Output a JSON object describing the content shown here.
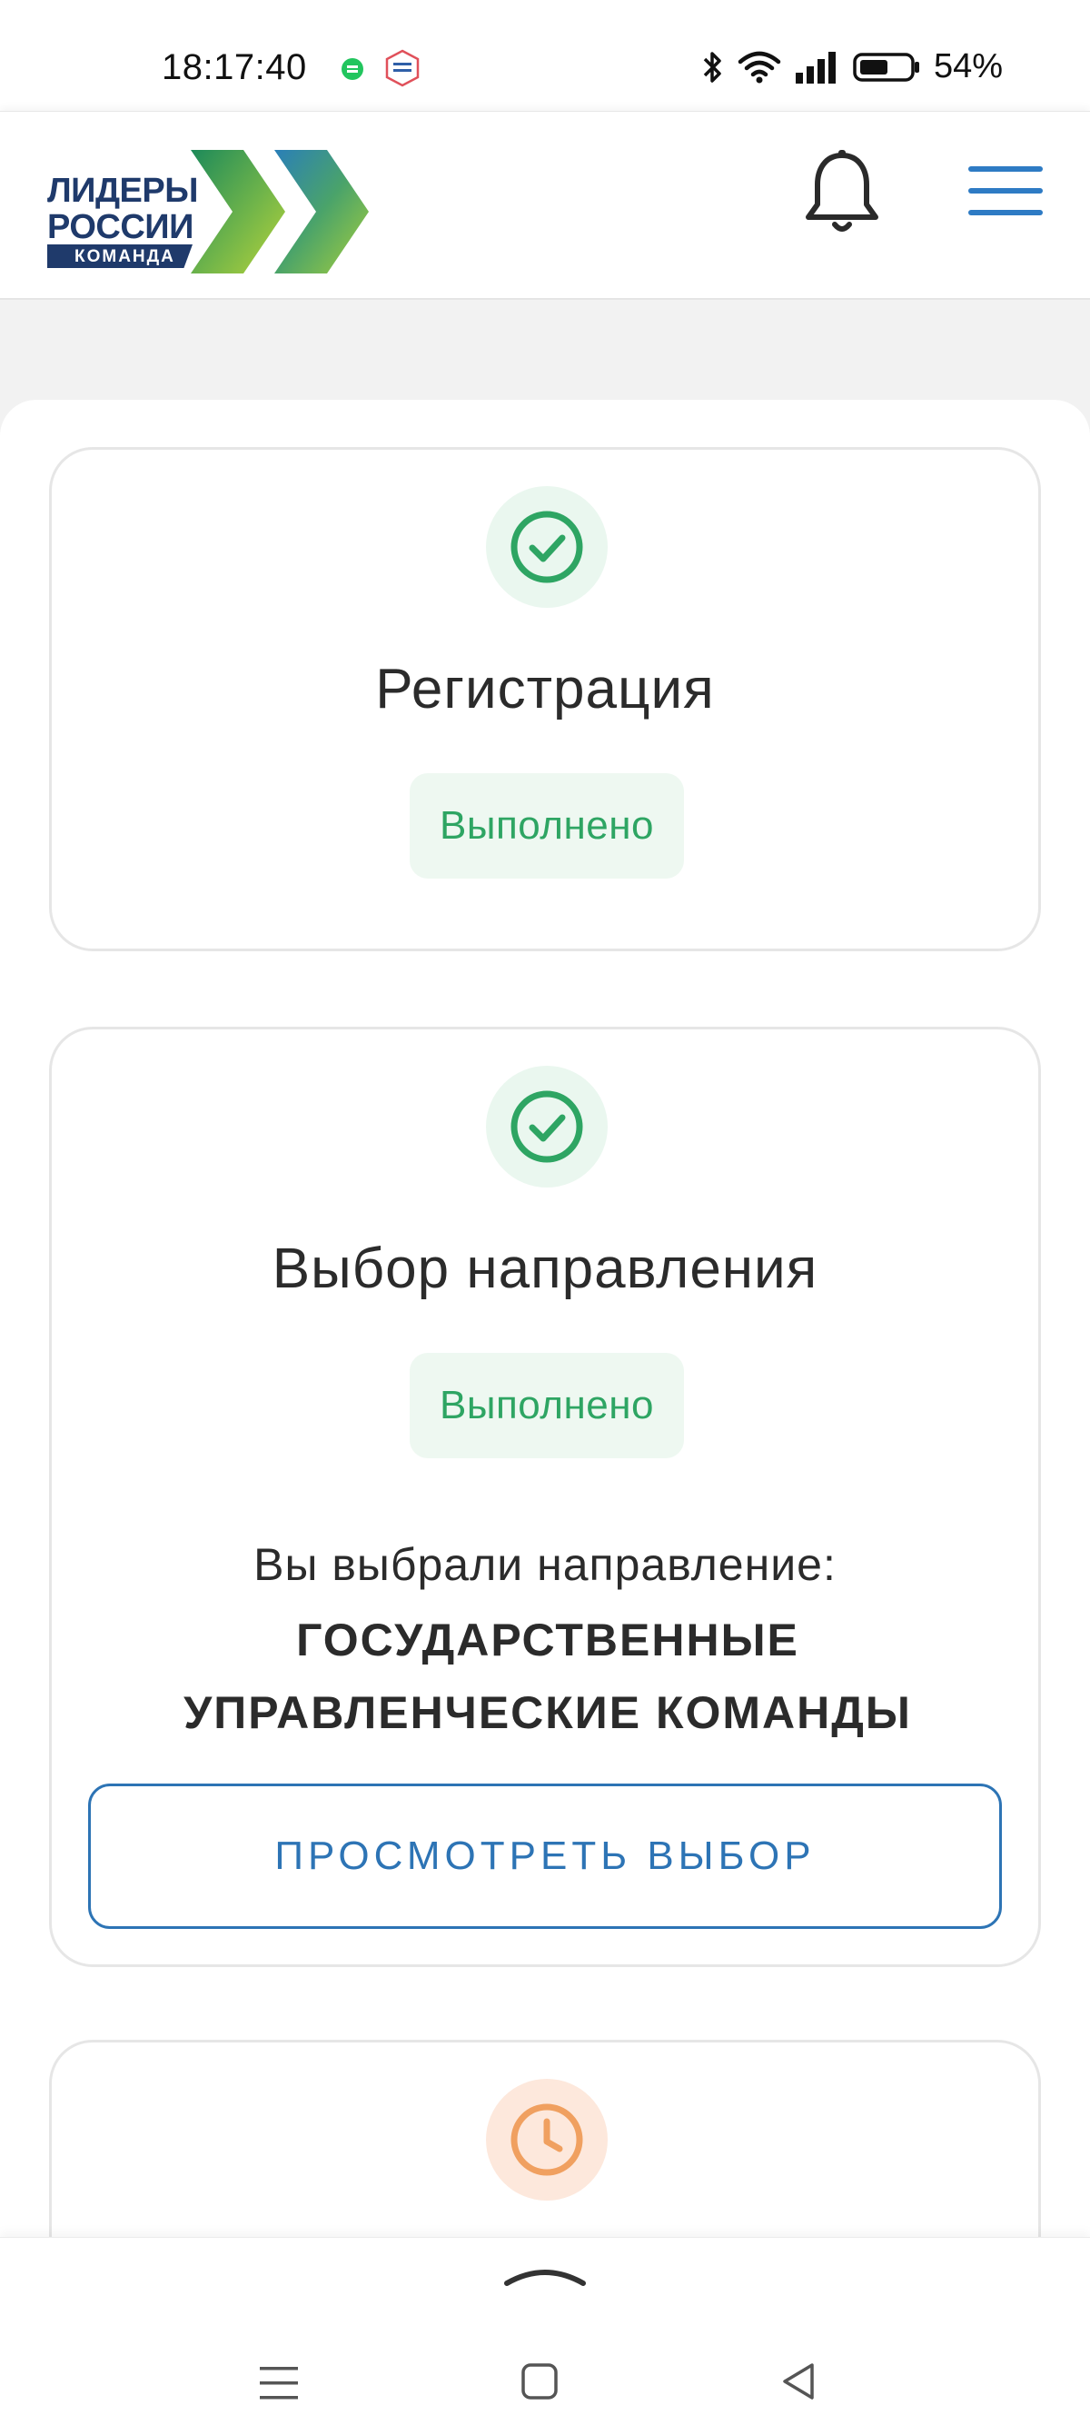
{
  "status_bar": {
    "time": "18:17:40",
    "battery": "54%",
    "icons": [
      "chat-app-icon",
      "gosuslugi-icon",
      "bluetooth-icon",
      "wifi-icon",
      "signal-icon",
      "battery-icon"
    ]
  },
  "header": {
    "logo": {
      "line1": "ЛИДЕРЫ",
      "line2": "РОССИИ",
      "ribbon": "КОМАНДА"
    },
    "icons": [
      "bell-icon",
      "hamburger-menu-icon"
    ],
    "accent_color": "#2e7bc4"
  },
  "steps": [
    {
      "title": "Регистрация",
      "status": "Выполнено",
      "state": "done",
      "icon": "check-circle-icon"
    },
    {
      "title": "Выбор направления",
      "status": "Выполнено",
      "state": "done",
      "icon": "check-circle-icon",
      "choice_label": "Вы выбрали направление:",
      "choice_value_line1": "ГОСУДАРСТВЕННЫЕ",
      "choice_value_line2": "УПРАВЛЕНЧЕСКИЕ КОМАНДЫ",
      "button_label": "ПРОСМОТРЕТЬ ВЫБОР"
    },
    {
      "state": "pending",
      "icon": "clock-icon"
    }
  ],
  "colors": {
    "done_green": "#2ea563",
    "done_bg": "#eef8f1",
    "pending_orange": "#f0a060",
    "button_blue": "#2d74b5"
  },
  "bottom_nav": {
    "icons": [
      "chevron-up-icon",
      "recent-apps-icon",
      "home-icon",
      "back-icon"
    ]
  }
}
